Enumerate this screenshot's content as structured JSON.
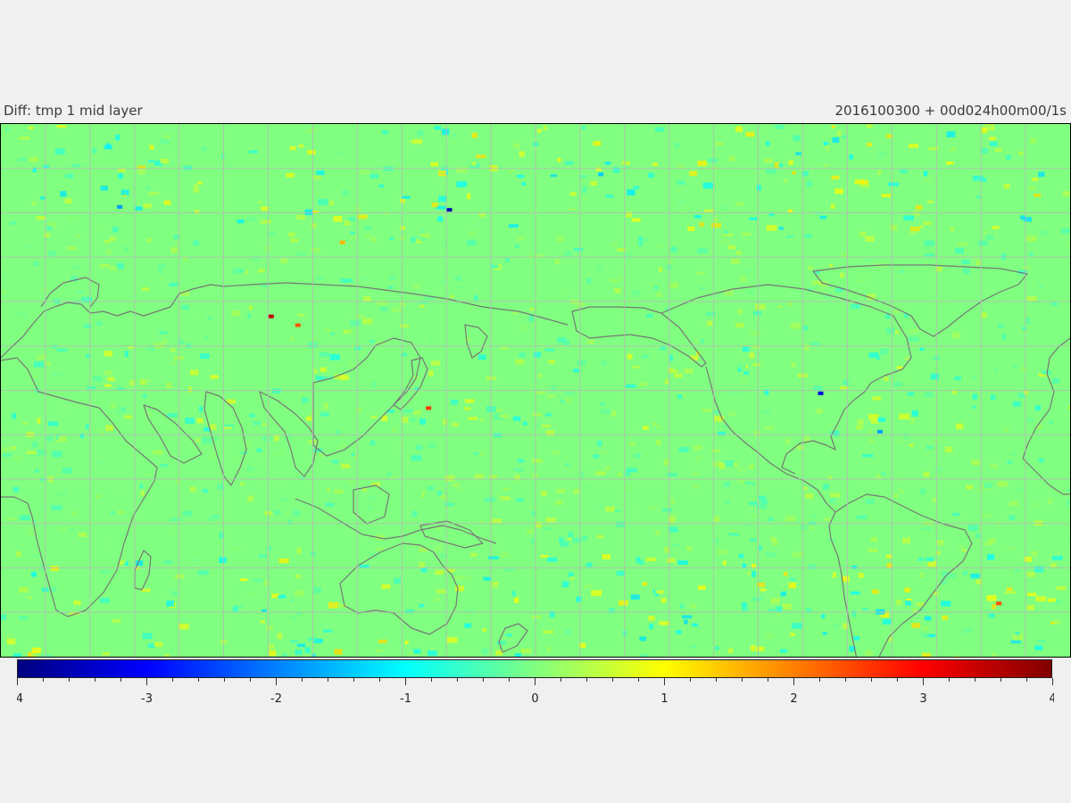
{
  "header": {
    "title_left": "Diff: tmp 1 mid layer",
    "title_right": "2016100300 + 00d024h00m00/1s"
  },
  "map": {
    "variable": "tmp 1 mid layer",
    "projection": "cylindrical-equidistant",
    "central_longitude": 180,
    "lon_range": [
      0,
      360
    ],
    "lat_range": [
      -90,
      90
    ],
    "gridline_spacing_deg": 15,
    "background_value": 0,
    "colors": {
      "field_zero": "#80ff80",
      "coastline": "#777777",
      "gridline": "#b8b8b8"
    },
    "notable_anomalies": [
      {
        "lon": 151,
        "lat": 61,
        "value": -3.6
      },
      {
        "lon": 91,
        "lat": 25,
        "value": 3.5
      },
      {
        "lon": 144,
        "lat": -6,
        "value": 2.6
      },
      {
        "lon": 276,
        "lat": -1,
        "value": -3.2
      },
      {
        "lon": 100,
        "lat": 22,
        "value": 2.3
      },
      {
        "lon": 336,
        "lat": -72,
        "value": 2.4
      },
      {
        "lon": 40,
        "lat": 62,
        "value": -1.8
      },
      {
        "lon": 115,
        "lat": 50,
        "value": 1.6
      },
      {
        "lon": 296,
        "lat": -14,
        "value": -1.7
      },
      {
        "lon": 202,
        "lat": 73,
        "value": -1.4
      }
    ]
  },
  "colorbar": {
    "colormap": "jet",
    "vmin": -4,
    "vmax": 4,
    "tick_labels": [
      "-4",
      "-3",
      "-2",
      "-1",
      "0",
      "1",
      "2",
      "3",
      "4"
    ],
    "minor_ticks_per_unit": 5
  }
}
